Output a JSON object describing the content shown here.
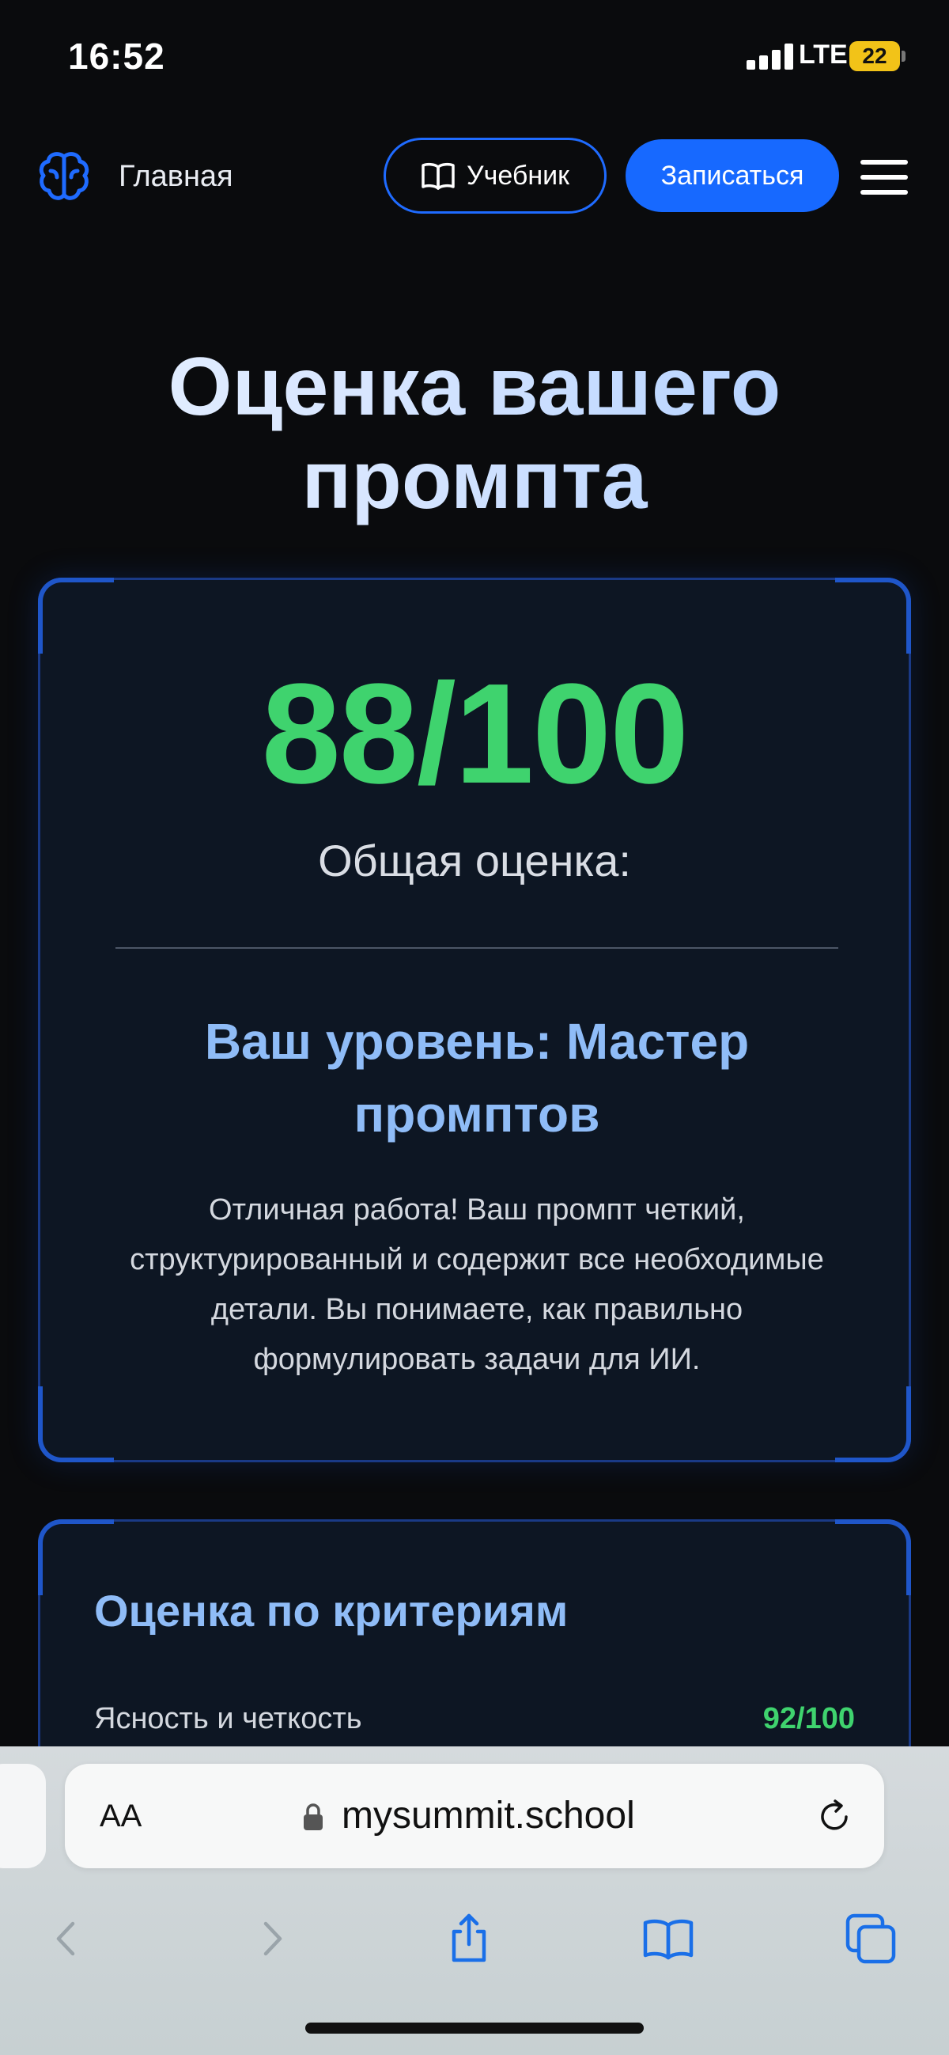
{
  "status_bar": {
    "time": "16:52",
    "network": "LTE",
    "battery": "22"
  },
  "nav": {
    "home_label": "Главная",
    "textbook_label": "Учебник",
    "enroll_label": "Записаться"
  },
  "page": {
    "title": "Оценка вашего промпта"
  },
  "score_card": {
    "score": "88/100",
    "score_label": "Общая оценка:",
    "level": "Ваш уровень: Мастер промптов",
    "description": "Отличная работа! Ваш промпт четкий, структурированный и содержит все необходимые детали. Вы понимаете, как правильно формулировать задачи для ИИ."
  },
  "criteria": {
    "title": "Оценка по критериям",
    "items": [
      {
        "name": "Ясность и четкость",
        "score": "92/100"
      }
    ]
  },
  "browser": {
    "aa_label": "AA",
    "url": "mysummit.school"
  },
  "colors": {
    "accent_blue": "#1769ff",
    "score_green": "#3fd36e",
    "heading_blue": "#8fbcf7",
    "card_bg": "#0d1623"
  },
  "icons": [
    "brain-icon",
    "book-icon",
    "menu-icon",
    "lock-icon",
    "reload-icon",
    "back-icon",
    "forward-icon",
    "share-icon",
    "bookmarks-icon",
    "tabs-icon"
  ]
}
